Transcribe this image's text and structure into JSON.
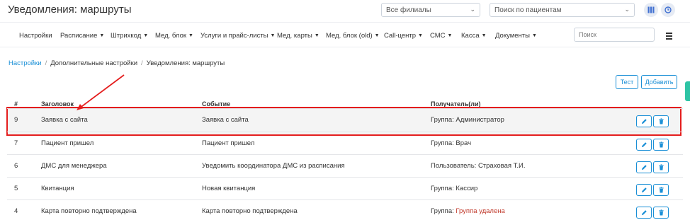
{
  "header": {
    "title": "Уведомления: маршруты",
    "filial_select": {
      "value": "Все филиалы"
    },
    "patient_search": {
      "placeholder": "Поиск по пациентам"
    }
  },
  "nav": {
    "items": [
      {
        "label": "Настройки",
        "dropdown": false
      },
      {
        "label": "Расписание",
        "dropdown": true
      },
      {
        "label": "Штрихкод",
        "dropdown": true
      },
      {
        "label": "Мед. блок",
        "dropdown": true
      },
      {
        "label": "Услуги и прайс-листы",
        "dropdown": true
      },
      {
        "label": "Мед. карты",
        "dropdown": true
      },
      {
        "label": "Мед. блок (old)",
        "dropdown": true
      },
      {
        "label": "Call-центр",
        "dropdown": true
      },
      {
        "label": "СМС",
        "dropdown": true
      },
      {
        "label": "Касса",
        "dropdown": true
      },
      {
        "label": "Документы",
        "dropdown": true
      }
    ],
    "search_placeholder": "Поиск"
  },
  "breadcrumb": [
    "Настройки",
    "Дополнительные настройки",
    "Уведомления: маршруты"
  ],
  "actions": {
    "test_label": "Тест",
    "add_label": "Добавить"
  },
  "table": {
    "headers": [
      "#",
      "Заголовок",
      "Событие",
      "Получатель(ли)"
    ],
    "rows": [
      {
        "num": "9",
        "title": "Заявка с сайта",
        "event": "Заявка с сайта",
        "recipient_prefix": "Группа:",
        "recipient": "Администратор",
        "deleted": false,
        "highlighted": true
      },
      {
        "num": "7",
        "title": "Пациент пришел",
        "event": "Пациент пришел",
        "recipient_prefix": "Группа:",
        "recipient": "Врач",
        "deleted": false,
        "highlighted": false
      },
      {
        "num": "6",
        "title": "ДМС для менеджера",
        "event": "Уведомить координатора ДМС из расписания",
        "recipient_prefix": "Пользователь:",
        "recipient": "Страховая Т.И.",
        "deleted": false,
        "highlighted": false
      },
      {
        "num": "5",
        "title": "Квитанция",
        "event": "Новая квитанция",
        "recipient_prefix": "Группа:",
        "recipient": "Кассир",
        "deleted": false,
        "highlighted": false
      },
      {
        "num": "4",
        "title": "Карта повторно подтверждена",
        "event": "Карта повторно подтверждена",
        "recipient_prefix": "Группа:",
        "recipient": "Группа удалена",
        "deleted": true,
        "highlighted": false
      }
    ]
  },
  "colors": {
    "accent": "#1a8fd6",
    "highlight_border": "#e41d1d",
    "deleted_text": "#c0392b",
    "side_tab": "#2ec4a5"
  },
  "icons": {
    "edit": "pencil-icon",
    "delete": "trash-icon",
    "columns": "columns-icon",
    "clock": "clock-icon"
  }
}
